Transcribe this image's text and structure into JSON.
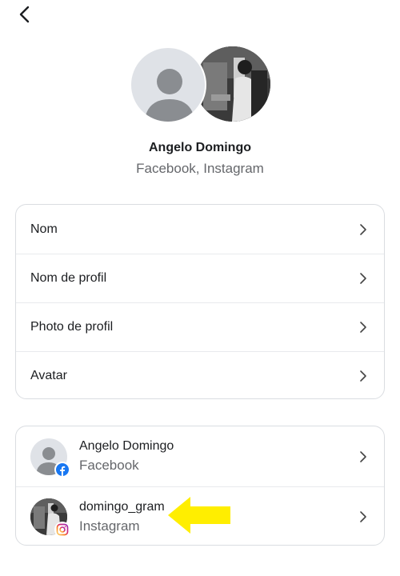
{
  "header": {
    "back_icon": "chevron-left-icon"
  },
  "profile": {
    "name": "Angelo Domingo",
    "platforms": "Facebook, Instagram"
  },
  "settings": {
    "items": [
      {
        "label": "Nom"
      },
      {
        "label": "Nom de profil"
      },
      {
        "label": "Photo de profil"
      },
      {
        "label": "Avatar"
      }
    ]
  },
  "accounts": {
    "items": [
      {
        "name": "Angelo Domingo",
        "platform": "Facebook",
        "badge_icon": "facebook-icon"
      },
      {
        "name": "domingo_gram",
        "platform": "Instagram",
        "badge_icon": "instagram-icon"
      }
    ]
  },
  "colors": {
    "accent_arrow": "#ffee00",
    "facebook": "#1877f2",
    "text_secondary": "#65676b"
  }
}
